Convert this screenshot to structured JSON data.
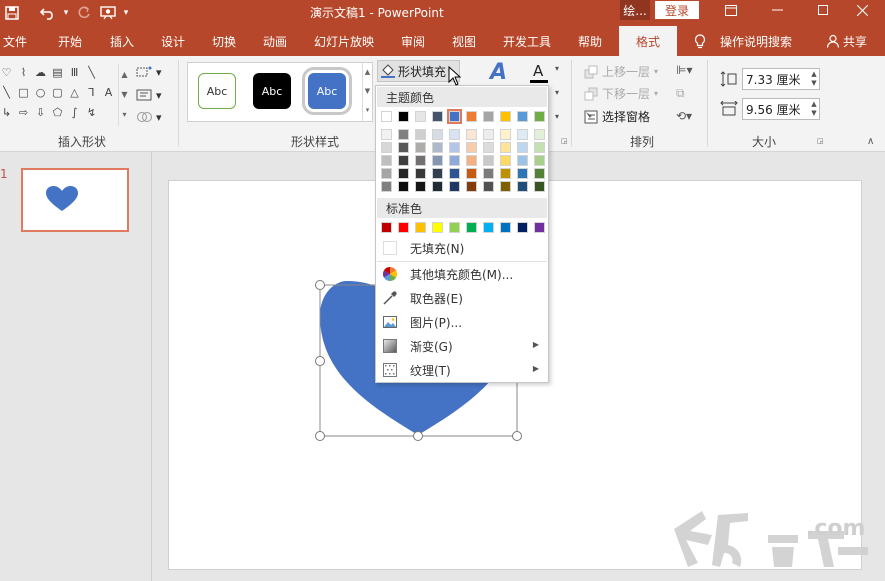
{
  "titlebar": {
    "title": "演示文稿1 - PowerPoint",
    "context_tab": "绘...",
    "login": "登录",
    "colors": {
      "bar": "#b7472a"
    }
  },
  "tabs": [
    {
      "label": "文件"
    },
    {
      "label": "开始"
    },
    {
      "label": "插入"
    },
    {
      "label": "设计"
    },
    {
      "label": "切换"
    },
    {
      "label": "动画"
    },
    {
      "label": "幻灯片放映"
    },
    {
      "label": "审阅"
    },
    {
      "label": "视图"
    },
    {
      "label": "开发工具"
    },
    {
      "label": "帮助"
    },
    {
      "label": "格式"
    }
  ],
  "tab_search": "操作说明搜索",
  "tab_share": "共享",
  "ribbon": {
    "insert_shapes_label": "插入形状",
    "shape_styles_label": "形状样式",
    "shape_style_presets": [
      {
        "label": "Abc"
      },
      {
        "label": "Abc"
      },
      {
        "label": "Abc"
      }
    ],
    "shape_fill_label": "形状填充",
    "arrange_label": "排列",
    "bring_forward": "上移一层",
    "send_backward": "下移一层",
    "selection_pane": "选择窗格",
    "size_label": "大小",
    "height_value": "7.33 厘米",
    "width_value": "9.56 厘米"
  },
  "slides": [
    {
      "number": "1"
    }
  ],
  "fill_menu": {
    "theme_colors_label": "主题颜色",
    "standard_colors_label": "标准色",
    "theme_top_row": [
      "#ffffff",
      "#000000",
      "#e7e6e6",
      "#44546a",
      "#4472c4",
      "#ed7d31",
      "#a5a5a5",
      "#ffc000",
      "#5b9bd5",
      "#70ad47"
    ],
    "theme_shades": [
      [
        "#f2f2f2",
        "#7f7f7f",
        "#d0cece",
        "#d6dce4",
        "#d9e2f3",
        "#fbe5d5",
        "#ededed",
        "#fff2cc",
        "#deebf6",
        "#e2efd9"
      ],
      [
        "#d8d8d8",
        "#595959",
        "#aeabab",
        "#adb9ca",
        "#b4c6e7",
        "#f7cbac",
        "#dbdbdb",
        "#fee599",
        "#bdd7ee",
        "#c5e0b3"
      ],
      [
        "#bfbfbf",
        "#3f3f3f",
        "#757070",
        "#8496b0",
        "#8eaadb",
        "#f4b183",
        "#c9c9c9",
        "#ffd965",
        "#9cc3e5",
        "#a8d08d"
      ],
      [
        "#a5a5a5",
        "#262626",
        "#3a3838",
        "#323f4f",
        "#2f5496",
        "#c55a11",
        "#7b7b7b",
        "#bf9000",
        "#2e75b5",
        "#538135"
      ],
      [
        "#7f7f7f",
        "#0c0c0c",
        "#171616",
        "#222a35",
        "#1f3864",
        "#833c0b",
        "#525252",
        "#7f6000",
        "#1e4e79",
        "#375623"
      ]
    ],
    "standard_colors": [
      "#c00000",
      "#ff0000",
      "#ffc000",
      "#ffff00",
      "#92d050",
      "#00b050",
      "#00b0f0",
      "#0070c0",
      "#002060",
      "#7030a0"
    ],
    "no_fill": "无填充(N)",
    "more_colors": "其他填充颜色(M)...",
    "eyedropper": "取色器(E)",
    "picture": "图片(P)...",
    "gradient": "渐变(G)",
    "texture": "纹理(T)"
  },
  "heart_color": "#4472c4",
  "watermark_text": ".com"
}
